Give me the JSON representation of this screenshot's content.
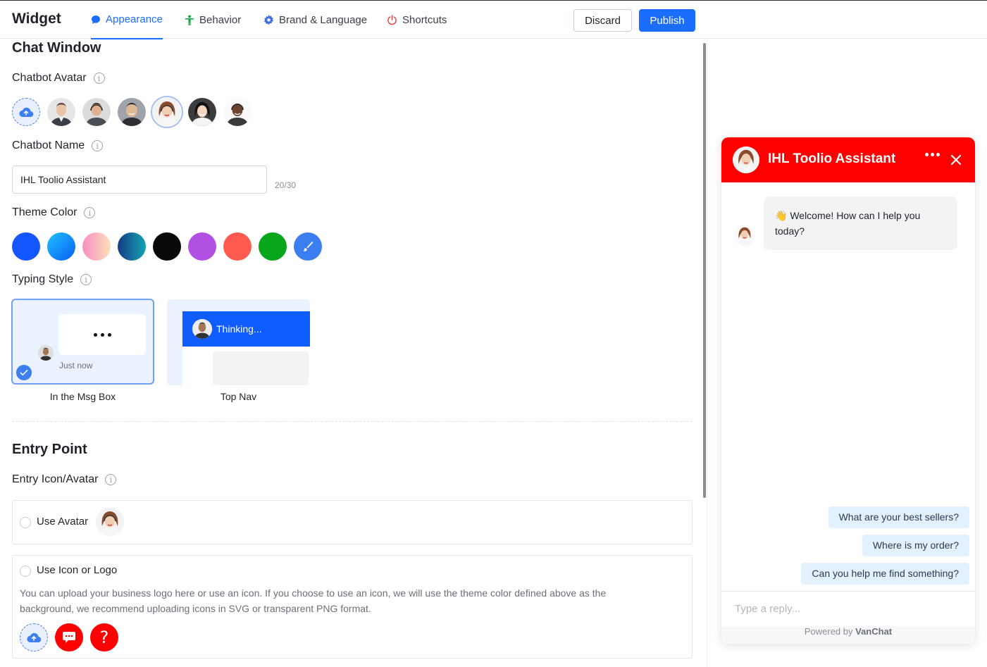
{
  "header": {
    "title": "Widget",
    "tabs": [
      {
        "label": "Appearance"
      },
      {
        "label": "Behavior"
      },
      {
        "label": "Brand & Language"
      },
      {
        "label": "Shortcuts"
      }
    ],
    "discard_label": "Discard",
    "publish_label": "Publish"
  },
  "chat_window": {
    "section_title": "Chat Window",
    "avatar_label": "Chatbot Avatar",
    "name_label": "Chatbot Name",
    "name_value": "IHL Toolio Assistant",
    "name_counter": "20/30",
    "theme_label": "Theme Color",
    "theme_colors": [
      "#1356ff",
      "#1a8cff",
      "#f6a7c8",
      "#146bab",
      "#0a0a0a",
      "#b150e2",
      "#ff5a4f",
      "#08a61b",
      "#3c7df0"
    ],
    "typing_label": "Typing Style",
    "typing_styles": [
      {
        "caption": "In the Msg Box",
        "timestamp": "Just now"
      },
      {
        "caption": "Top Nav",
        "banner": "Thinking..."
      }
    ]
  },
  "entry_point": {
    "section_title": "Entry Point",
    "icon_label": "Entry Icon/Avatar",
    "use_avatar_label": "Use Avatar",
    "use_icon_label": "Use Icon or Logo",
    "description_line1": "You can upload your business logo here or use an icon. If you choose to use an icon, we will use the theme color defined above as the",
    "description_line2": "background, we recommend uploading icons in SVG or transparent PNG format.",
    "icons": [
      "upload-cloud-icon",
      "chat-bubble-icon",
      "question-icon"
    ],
    "icon_color": "#ff0000"
  },
  "preview": {
    "title": "IHL Toolio Assistant",
    "header_color": "#ff0000",
    "welcome_emoji": "👋",
    "welcome_text": "Welcome! How can I help you today?",
    "quick_replies": [
      "What are your best sellers?",
      "Where is my order?",
      "Can you help me find something?"
    ],
    "input_placeholder": "Type a reply...",
    "powered_prefix": "Powered by",
    "powered_brand": "VanChat"
  }
}
